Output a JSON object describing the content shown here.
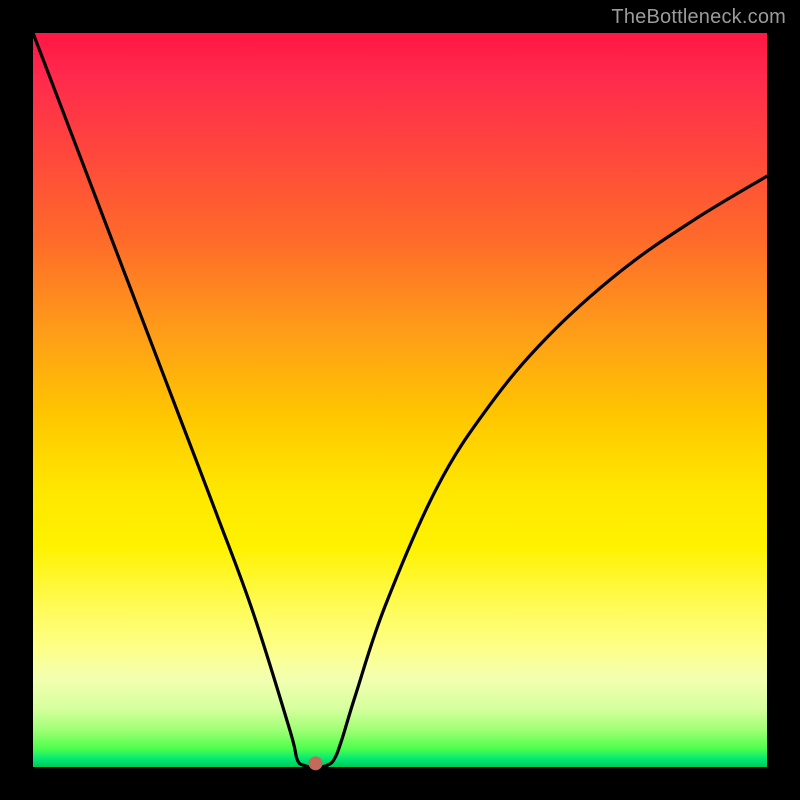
{
  "watermark": "TheBottleneck.com",
  "chart_data": {
    "type": "line",
    "title": "",
    "xlabel": "",
    "ylabel": "",
    "xlim": [
      0,
      100
    ],
    "ylim": [
      0,
      100
    ],
    "grid": false,
    "legend": false,
    "series": [
      {
        "name": "bottleneck-curve",
        "x": [
          0,
          5,
          10,
          15,
          20,
          25,
          30,
          35,
          36,
          37,
          38,
          39,
          40,
          41,
          42,
          44,
          48,
          55,
          62,
          70,
          80,
          90,
          100
        ],
        "y": [
          100,
          86.9,
          73.8,
          60.7,
          47.6,
          34.5,
          21.0,
          5.0,
          1.0,
          0.2,
          0.0,
          0.0,
          0.2,
          1.0,
          3.5,
          10.0,
          22.0,
          38.0,
          49.0,
          58.5,
          67.5,
          74.5,
          80.5
        ]
      }
    ],
    "marker": {
      "name": "optimal-point",
      "x": 38.5,
      "y": 0.5,
      "color": "#c46a5a",
      "radius_px": 7
    },
    "colors": {
      "curve": "#000000",
      "background_top": "#ff1744",
      "background_bottom": "#00c853",
      "frame": "#000000"
    }
  }
}
